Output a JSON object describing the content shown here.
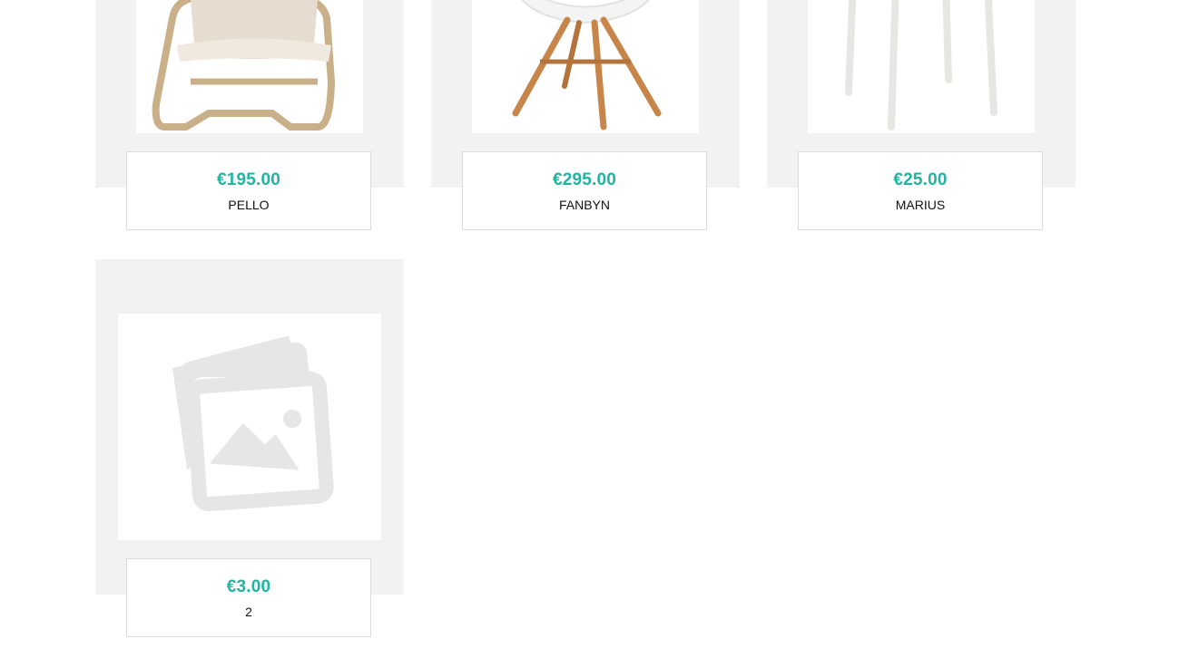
{
  "products": [
    {
      "price": "€195.00",
      "name": "PELLO",
      "image": "armchair-icon"
    },
    {
      "price": "€295.00",
      "name": "FANBYN",
      "image": "chair-icon"
    },
    {
      "price": "€25.00",
      "name": "MARIUS",
      "image": "stool-icon"
    },
    {
      "price": "€3.00",
      "name": "2",
      "image": "image-placeholder-icon"
    }
  ],
  "colors": {
    "price": "#1fb5a1",
    "card_bg": "#f2f2f2",
    "border": "#dcdcdc"
  }
}
